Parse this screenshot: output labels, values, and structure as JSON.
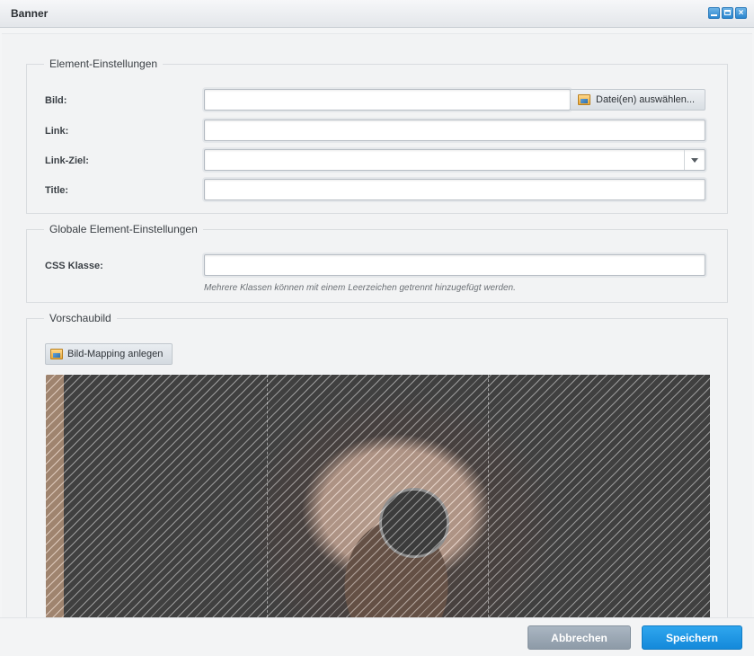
{
  "window": {
    "title": "Banner",
    "controls": [
      "minimize",
      "maximize",
      "close"
    ],
    "close_symbol": "×"
  },
  "element_settings": {
    "legend": "Element-Einstellungen",
    "image": {
      "label": "Bild:",
      "value": "",
      "button_label": "Datei(en) auswählen...",
      "button_icon": "image-icon"
    },
    "link": {
      "label": "Link:",
      "value": ""
    },
    "link_target": {
      "label": "Link-Ziel:",
      "value": ""
    },
    "title": {
      "label": "Title:",
      "value": ""
    }
  },
  "global_settings": {
    "legend": "Globale Element-Einstellungen",
    "css_class": {
      "label": "CSS Klasse:",
      "value": "",
      "hint": "Mehrere Klassen können mit einem Leerzeichen getrennt hinzugefügt werden."
    }
  },
  "preview": {
    "legend": "Vorschaubild",
    "mapping_button_label": "Bild-Mapping anlegen",
    "mapping_button_icon": "image-mapping-icon"
  },
  "footer": {
    "cancel_label": "Abbrechen",
    "save_label": "Speichern"
  },
  "colors": {
    "accent": "#1b8fdd",
    "cancel": "#9aa6b2"
  }
}
